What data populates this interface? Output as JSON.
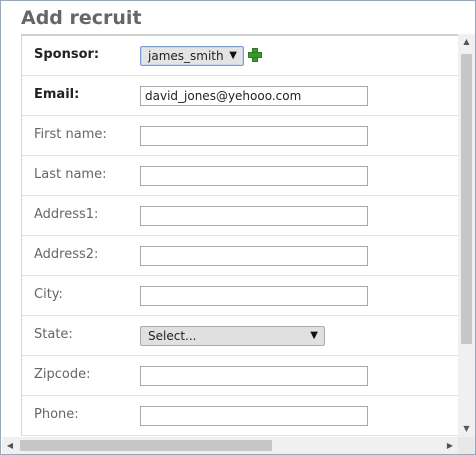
{
  "dialog": {
    "title": "Add recruit"
  },
  "form": {
    "sponsor": {
      "label": "Sponsor:",
      "value": "james_smith",
      "add_icon": "plus-icon"
    },
    "email": {
      "label": "Email:",
      "value": "david_jones@yehooo.com"
    },
    "first_name": {
      "label": "First name:",
      "value": ""
    },
    "last_name": {
      "label": "Last name:",
      "value": ""
    },
    "address1": {
      "label": "Address1:",
      "value": ""
    },
    "address2": {
      "label": "Address2:",
      "value": ""
    },
    "city": {
      "label": "City:",
      "value": ""
    },
    "state": {
      "label": "State:",
      "value": "Select..."
    },
    "zipcode": {
      "label": "Zipcode:",
      "value": ""
    },
    "phone": {
      "label": "Phone:",
      "value": ""
    }
  },
  "icons": {
    "dropdown": "▼",
    "scroll_up": "▲",
    "scroll_down": "▼",
    "scroll_left": "◀",
    "scroll_right": "▶"
  },
  "colors": {
    "title": "#666666",
    "add_icon": "#3a9a2e",
    "focus_border": "#7b9ccf"
  }
}
